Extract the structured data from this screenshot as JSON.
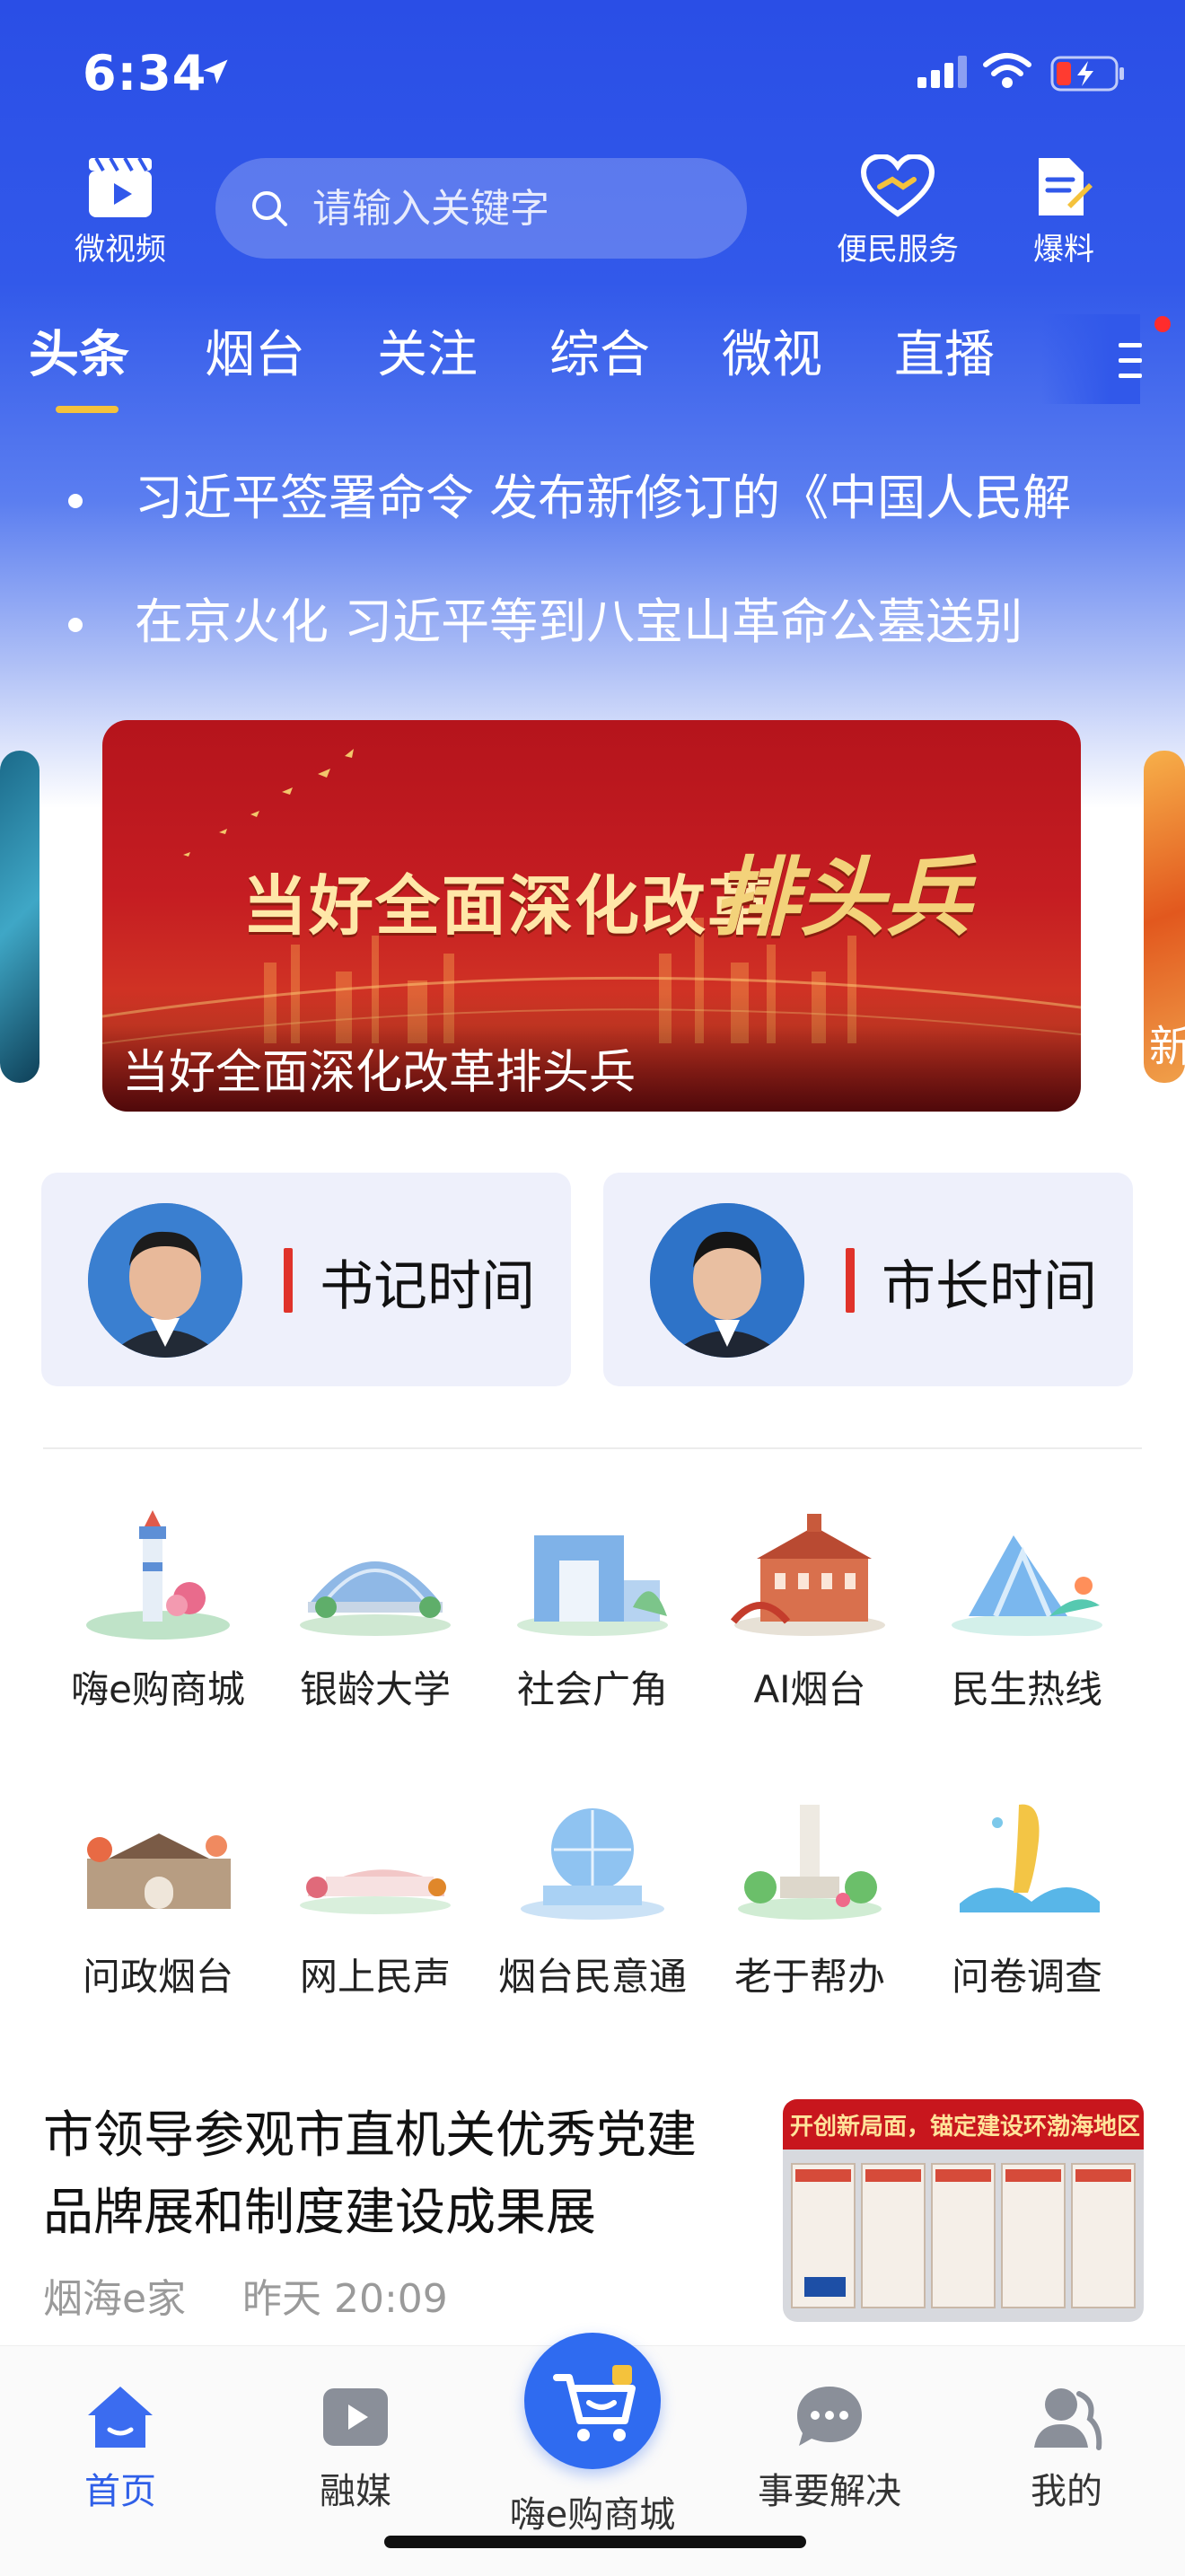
{
  "status_bar": {
    "time": "6:34"
  },
  "header": {
    "video_label": "微视频",
    "search_placeholder": "请输入关键字",
    "service_label": "便民服务",
    "report_label": "爆料"
  },
  "tabs": [
    "头条",
    "烟台",
    "关注",
    "综合",
    "微视",
    "直播"
  ],
  "ticker": [
    "习近平签署命令 发布新修订的《中国人民解",
    "在京火化 习近平等到八宝山革命公墓送别"
  ],
  "banner": {
    "slogan_text": "当好全面深化改革",
    "slogan_script": "排头兵",
    "caption": "当好全面深化改革排头兵",
    "right_peek_text": "新"
  },
  "leaders": [
    {
      "label": "书记时间"
    },
    {
      "label": "市长时间"
    }
  ],
  "grid": [
    {
      "label": "嗨e购商城",
      "icon": "lighthouse-icon"
    },
    {
      "label": "银龄大学",
      "icon": "dome-building-icon"
    },
    {
      "label": "社会广角",
      "icon": "gate-building-icon"
    },
    {
      "label": "AI烟台",
      "icon": "red-building-icon"
    },
    {
      "label": "民生热线",
      "icon": "wave-building-icon"
    },
    {
      "label": "问政烟台",
      "icon": "city-wall-icon"
    },
    {
      "label": "网上民声",
      "icon": "pavilion-icon"
    },
    {
      "label": "烟台民意通",
      "icon": "sphere-building-icon"
    },
    {
      "label": "老于帮办",
      "icon": "monument-icon"
    },
    {
      "label": "问卷调查",
      "icon": "statue-icon"
    }
  ],
  "article": {
    "title": "市领导参观市直机关优秀党建品牌展和制度建设成果展",
    "source": "烟海e家",
    "time": "昨天 20:09",
    "thumb_banner_text": "开创新局面，锚定建设环渤海地区中"
  },
  "bottom_nav": [
    {
      "label": "首页"
    },
    {
      "label": "融媒"
    },
    {
      "label": "嗨e购商城"
    },
    {
      "label": "事要解决"
    },
    {
      "label": "我的"
    }
  ],
  "colors": {
    "primary": "#2f5fe8",
    "accent_red": "#e0332a",
    "tab_indicator": "#f4c23c"
  }
}
